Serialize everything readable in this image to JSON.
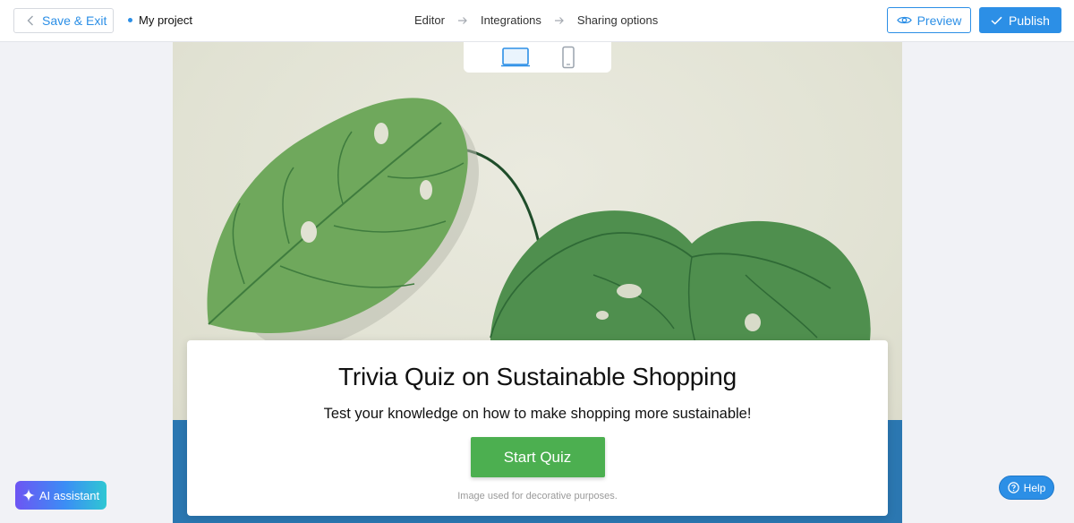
{
  "header": {
    "save_exit_label": "Save & Exit",
    "project_name": "My project",
    "steps": [
      "Editor",
      "Integrations",
      "Sharing options"
    ],
    "preview_label": "Preview",
    "publish_label": "Publish"
  },
  "device_toggle": {
    "options": [
      "desktop-icon",
      "mobile-icon"
    ],
    "selected": "desktop"
  },
  "quiz_card": {
    "title": "Trivia Quiz on Sustainable Shopping",
    "subtitle": "Test your knowledge on how to make shopping more sustainable!",
    "start_label": "Start Quiz",
    "image_note": "Image used for decorative purposes."
  },
  "floating": {
    "ai_assistant_label": "AI assistant",
    "help_label": "Help"
  },
  "colors": {
    "accent": "#2c8fe6",
    "start_button": "#4caf50",
    "canvas_bottom": "#2b77b1",
    "leaf_green": "#5f9e52"
  }
}
